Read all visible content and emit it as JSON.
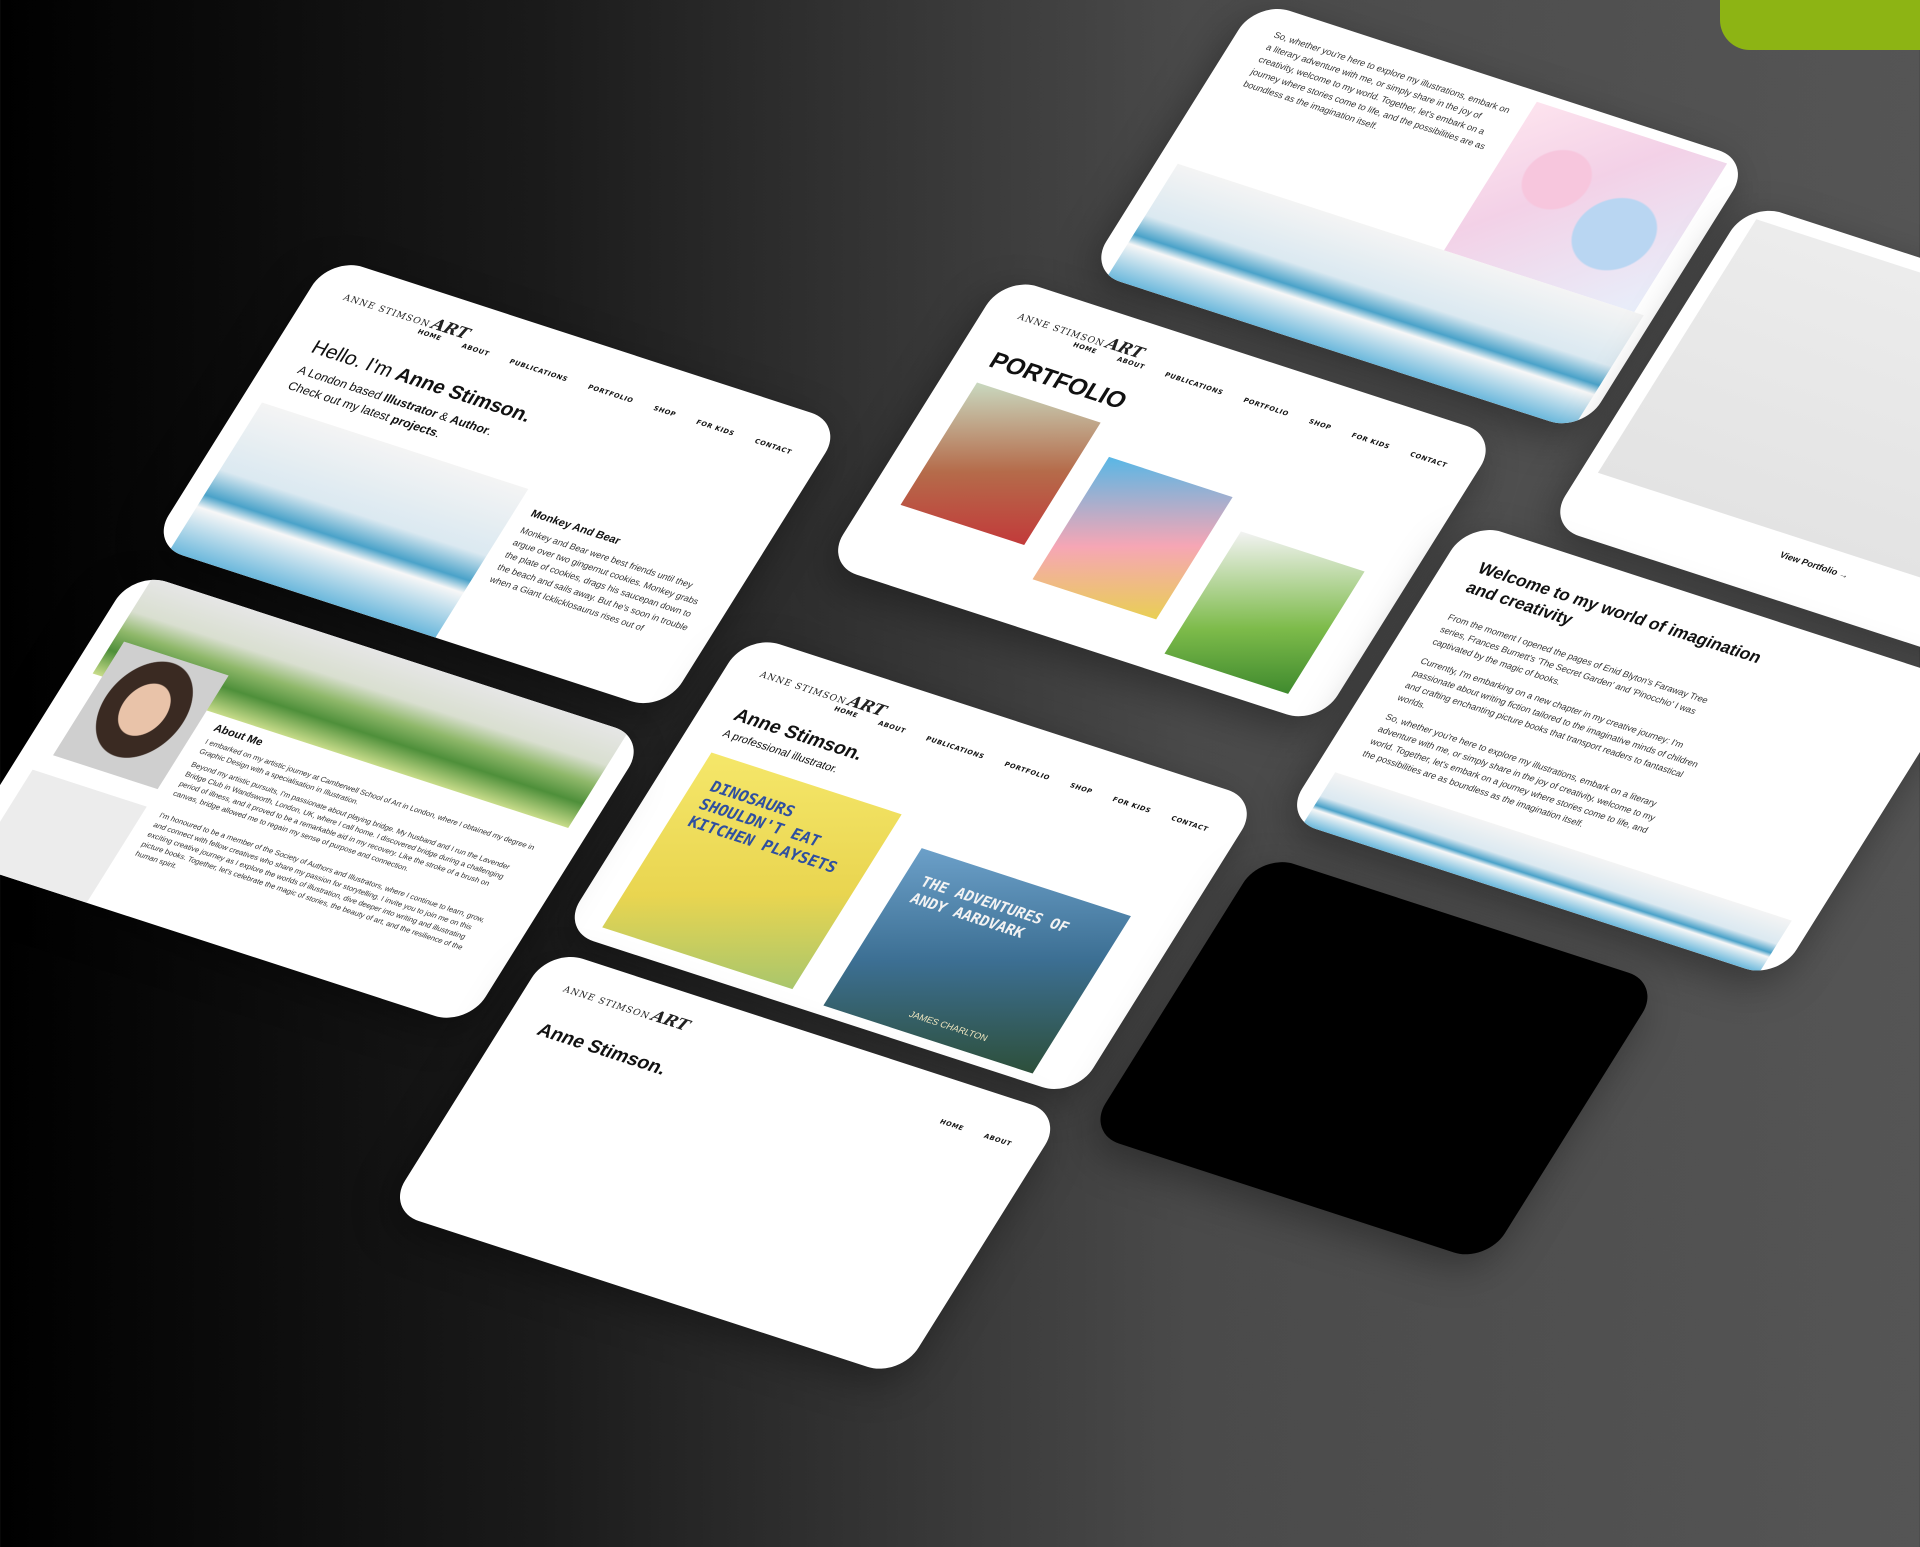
{
  "site": {
    "logo_name": "ANNE STIMSON",
    "logo_mark": "ART"
  },
  "nav": [
    "HOME",
    "ABOUT",
    "PUBLICATIONS",
    "PORTFOLIO",
    "SHOP",
    "FOR KIDS",
    "CONTACT"
  ],
  "hero": {
    "greeting": "Hello. I'm",
    "name": "Anne Stimson.",
    "line1": "A London based",
    "role1": "Illustrator",
    "amp": "&",
    "role2": "Author",
    "line2": "Check out my latest",
    "projects": "projects"
  },
  "project": {
    "title": "Monkey And Bear",
    "text": "Monkey and Bear were best friends until they argue over two gingernut cookies. Monkey grabs the plate of cookies, drags his saucepan down to the beach and sails away. But he's soon in trouble when a Giant Icklicklosaurus rises out of"
  },
  "portfolio": {
    "title": "PORTFOLIO",
    "view_link": "View Portfolio"
  },
  "publications": {
    "name": "Anne Stimson.",
    "tagline": "A professional illustrator.",
    "book1": "DINOSAURS SHOULDN'T EAT KITCHEN PLAYSETS",
    "book2": "THE ADVENTURES OF ANDY AARDVARK",
    "book2_author": "JAMES CHARLTON"
  },
  "welcome": {
    "title": "Welcome to my world of imagination and creativity",
    "p1": "From the moment I opened the pages of Enid Blyton's Faraway Tree series, Frances Burnett's 'The Secret Garden' and 'Pinocchio' I was captivated by the magic of books.",
    "p2": "Currently, I'm embarking on a new chapter in my creative journey: I'm passionate about writing fiction tailored to the imaginative minds of children and crafting enchanting picture books that transport readers to fantastical worlds.",
    "p3": "So, whether you're here to explore my illustrations, embark on a literary adventure with me, or simply share in the joy of creativity, welcome to my world. Together, let's embark on a journey where stories come to life, and the possibilities are as boundless as the imagination itself."
  },
  "about": {
    "title": "About Me",
    "p1": "I embarked on my artistic journey at Camberwell School of Art in London, where I obtained my degree in Graphic Design with a specialisation in Illustration.",
    "p2": "Beyond my artistic pursuits, I'm passionate about playing bridge. My husband and I run the Lavender Bridge Club in Wandsworth, London, UK, where I call home. I discovered bridge during a challenging period of illness, and it proved to be a remarkable aid in my recovery. Like the stroke of a brush on canvas, bridge allowed me to regain my sense of purpose and connection.",
    "p3": "I'm honoured to be a member of the Society of Authors and Illustrators, where I continue to learn, grow, and connect with fellow creatives who share my passion for storytelling. I invite you to join me on this exciting creative journey as I explore the worlds of illustration, dive deeper into writing and illustrating picture books. Together, let's celebrate the magic of stories, the beauty of art, and the resilience of the human spirit."
  }
}
